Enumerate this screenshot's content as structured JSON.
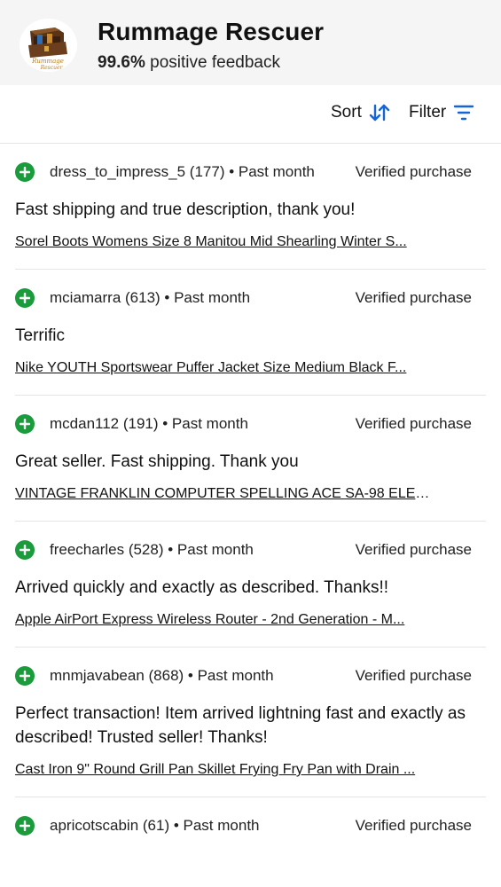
{
  "seller": {
    "name": "Rummage Rescuer",
    "feedback_pct": "99.6%",
    "feedback_label": "positive feedback",
    "logo_text": "Rummage Rescuer"
  },
  "toolbar": {
    "sort_label": "Sort",
    "sort_icon": "sort-arrows-icon",
    "filter_label": "Filter",
    "filter_icon": "filter-lines-icon",
    "accent_color": "#1565d8"
  },
  "reviews": [
    {
      "user": "dress_to_impress_5 (177) • Past month",
      "verified": "Verified purchase",
      "comment": "Fast shipping and true description, thank you!",
      "item": "Sorel Boots Womens Size 8 Manitou Mid Shearling Winter S..."
    },
    {
      "user": "mciamarra (613) • Past month",
      "verified": "Verified purchase",
      "comment": "Terrific",
      "item": "Nike YOUTH Sportswear Puffer Jacket Size Medium Black F..."
    },
    {
      "user": "mcdan112 (191) • Past month",
      "verified": "Verified purchase",
      "comment": "Great seller. Fast shipping. Thank you",
      "item": "VINTAGE FRANKLIN COMPUTER SPELLING ACE SA-98 ELEC..."
    },
    {
      "user": "freecharles (528) • Past month",
      "verified": "Verified purchase",
      "comment": "Arrived quickly and exactly as described. Thanks!!",
      "item": "Apple AirPort Express Wireless Router - 2nd Generation - M..."
    },
    {
      "user": "mnmjavabean (868) • Past month",
      "verified": "Verified purchase",
      "comment": "Perfect transaction! Item arrived lightning fast and exactly as described! Trusted seller! Thanks!",
      "item": "Cast Iron 9\" Round Grill Pan Skillet Frying Fry Pan with Drain ..."
    },
    {
      "user": "apricotscabin (61) • Past month",
      "verified": "Verified purchase"
    }
  ],
  "colors": {
    "positive": "#1a9b3c",
    "header_bg": "#f5f5f5"
  }
}
